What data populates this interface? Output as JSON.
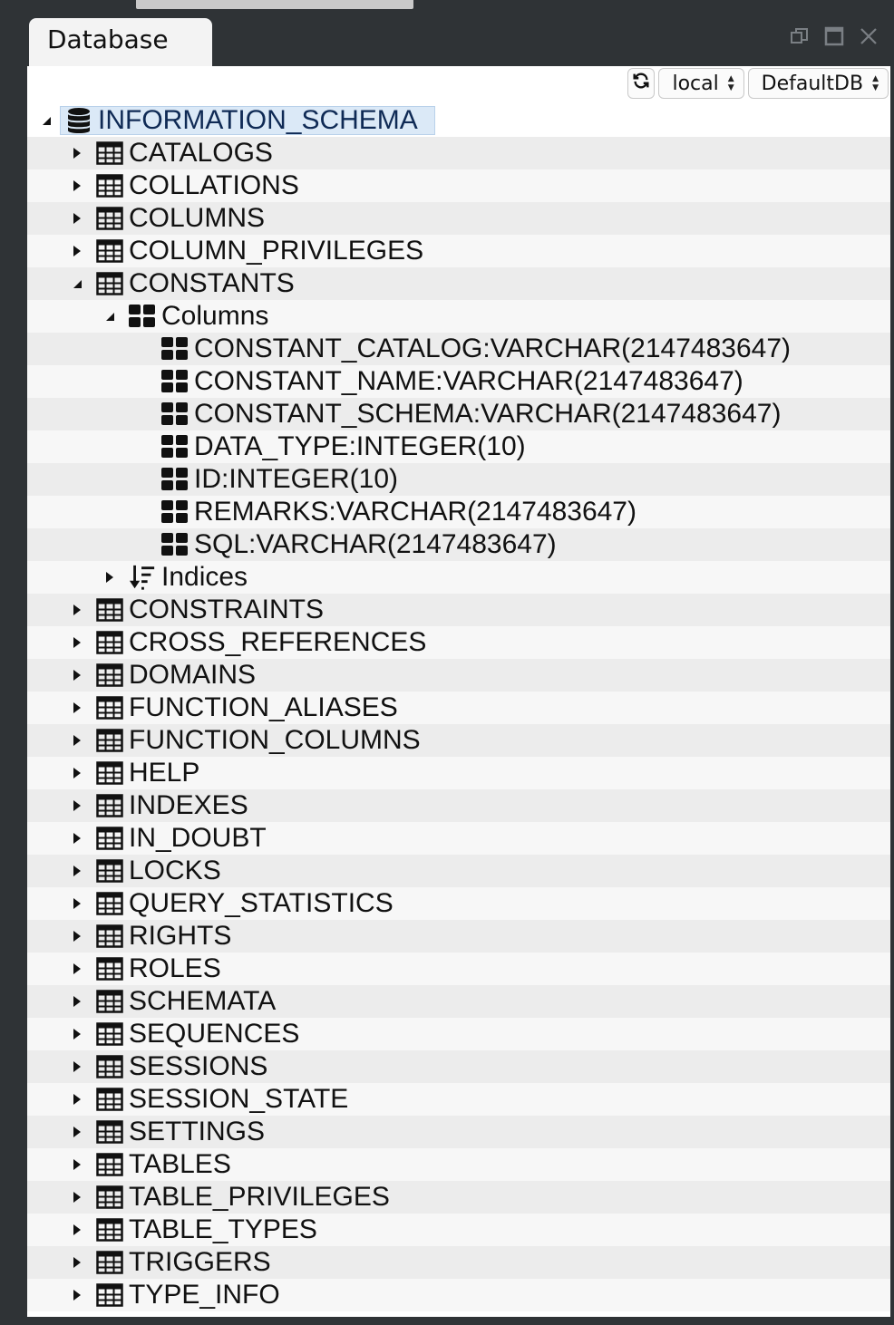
{
  "tab": {
    "title": "Database"
  },
  "toolbar": {
    "connection": "local",
    "database": "DefaultDB"
  },
  "tree": [
    {
      "level": 0,
      "toggle": "expanded",
      "icon": "database",
      "label": "INFORMATION_SCHEMA"
    },
    {
      "level": 1,
      "toggle": "collapsed",
      "icon": "table",
      "label": "CATALOGS"
    },
    {
      "level": 1,
      "toggle": "collapsed",
      "icon": "table",
      "label": "COLLATIONS"
    },
    {
      "level": 1,
      "toggle": "collapsed",
      "icon": "table",
      "label": "COLUMNS"
    },
    {
      "level": 1,
      "toggle": "collapsed",
      "icon": "table",
      "label": "COLUMN_PRIVILEGES"
    },
    {
      "level": 1,
      "toggle": "expanded",
      "icon": "table",
      "label": "CONSTANTS"
    },
    {
      "level": 2,
      "toggle": "expanded",
      "icon": "columns",
      "label": "Columns"
    },
    {
      "level": 3,
      "toggle": "none",
      "icon": "column",
      "label": "CONSTANT_CATALOG:VARCHAR(2147483647)"
    },
    {
      "level": 3,
      "toggle": "none",
      "icon": "column",
      "label": "CONSTANT_NAME:VARCHAR(2147483647)"
    },
    {
      "level": 3,
      "toggle": "none",
      "icon": "column",
      "label": "CONSTANT_SCHEMA:VARCHAR(2147483647)"
    },
    {
      "level": 3,
      "toggle": "none",
      "icon": "column",
      "label": "DATA_TYPE:INTEGER(10)"
    },
    {
      "level": 3,
      "toggle": "none",
      "icon": "column",
      "label": "ID:INTEGER(10)"
    },
    {
      "level": 3,
      "toggle": "none",
      "icon": "column",
      "label": "REMARKS:VARCHAR(2147483647)"
    },
    {
      "level": 3,
      "toggle": "none",
      "icon": "column",
      "label": "SQL:VARCHAR(2147483647)"
    },
    {
      "level": 2,
      "toggle": "collapsed",
      "icon": "indices",
      "label": "Indices"
    },
    {
      "level": 1,
      "toggle": "collapsed",
      "icon": "table",
      "label": "CONSTRAINTS"
    },
    {
      "level": 1,
      "toggle": "collapsed",
      "icon": "table",
      "label": "CROSS_REFERENCES"
    },
    {
      "level": 1,
      "toggle": "collapsed",
      "icon": "table",
      "label": "DOMAINS"
    },
    {
      "level": 1,
      "toggle": "collapsed",
      "icon": "table",
      "label": "FUNCTION_ALIASES"
    },
    {
      "level": 1,
      "toggle": "collapsed",
      "icon": "table",
      "label": "FUNCTION_COLUMNS"
    },
    {
      "level": 1,
      "toggle": "collapsed",
      "icon": "table",
      "label": "HELP"
    },
    {
      "level": 1,
      "toggle": "collapsed",
      "icon": "table",
      "label": "INDEXES"
    },
    {
      "level": 1,
      "toggle": "collapsed",
      "icon": "table",
      "label": "IN_DOUBT"
    },
    {
      "level": 1,
      "toggle": "collapsed",
      "icon": "table",
      "label": "LOCKS"
    },
    {
      "level": 1,
      "toggle": "collapsed",
      "icon": "table",
      "label": "QUERY_STATISTICS"
    },
    {
      "level": 1,
      "toggle": "collapsed",
      "icon": "table",
      "label": "RIGHTS"
    },
    {
      "level": 1,
      "toggle": "collapsed",
      "icon": "table",
      "label": "ROLES"
    },
    {
      "level": 1,
      "toggle": "collapsed",
      "icon": "table",
      "label": "SCHEMATA"
    },
    {
      "level": 1,
      "toggle": "collapsed",
      "icon": "table",
      "label": "SEQUENCES"
    },
    {
      "level": 1,
      "toggle": "collapsed",
      "icon": "table",
      "label": "SESSIONS"
    },
    {
      "level": 1,
      "toggle": "collapsed",
      "icon": "table",
      "label": "SESSION_STATE"
    },
    {
      "level": 1,
      "toggle": "collapsed",
      "icon": "table",
      "label": "SETTINGS"
    },
    {
      "level": 1,
      "toggle": "collapsed",
      "icon": "table",
      "label": "TABLES"
    },
    {
      "level": 1,
      "toggle": "collapsed",
      "icon": "table",
      "label": "TABLE_PRIVILEGES"
    },
    {
      "level": 1,
      "toggle": "collapsed",
      "icon": "table",
      "label": "TABLE_TYPES"
    },
    {
      "level": 1,
      "toggle": "collapsed",
      "icon": "table",
      "label": "TRIGGERS"
    },
    {
      "level": 1,
      "toggle": "collapsed",
      "icon": "table",
      "label": "TYPE_INFO"
    }
  ]
}
